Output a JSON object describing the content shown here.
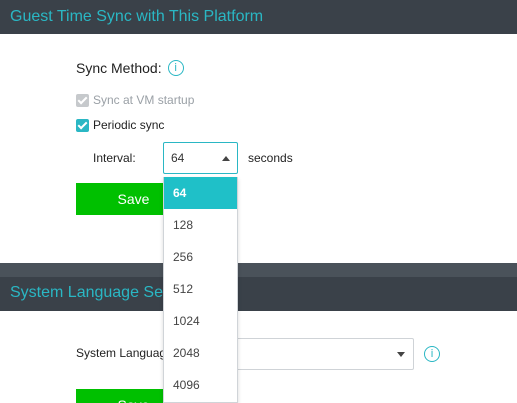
{
  "sections": {
    "time_sync": {
      "title": "Guest Time Sync with This Platform",
      "sync_method_label": "Sync Method:",
      "sync_at_startup": {
        "label": "Sync at VM startup",
        "checked": true,
        "disabled": true
      },
      "periodic_sync": {
        "label": "Periodic sync",
        "checked": true
      },
      "interval": {
        "label": "Interval:",
        "value": "64",
        "unit": "seconds",
        "options": [
          "64",
          "128",
          "256",
          "512",
          "1024",
          "2048",
          "4096"
        ],
        "selected_index": 0
      },
      "save_label": "Save"
    },
    "system_language": {
      "title": "System Language Se",
      "label": "System Languag",
      "value": "",
      "save_label": "Save"
    }
  },
  "colors": {
    "header_bg": "#3a4149",
    "accent": "#2ab7c4",
    "save_button": "#00c000",
    "dropdown_selected": "#1fc0c8"
  },
  "icons": {
    "info": "info-circle-icon",
    "caret_up": "caret-up-icon",
    "caret_down": "caret-down-icon"
  }
}
